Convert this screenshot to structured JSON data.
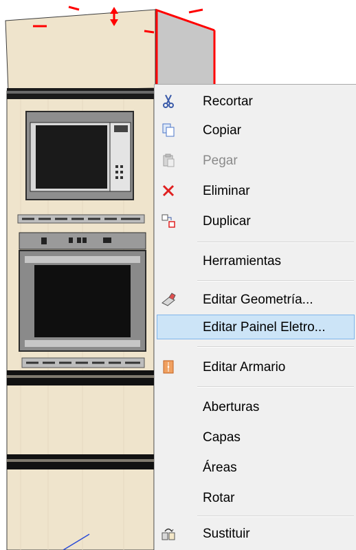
{
  "context_menu": {
    "items": [
      {
        "label": "Recortar",
        "icon": "scissors-icon",
        "enabled": true
      },
      {
        "label": "Copiar",
        "icon": "copy-icon",
        "enabled": true
      },
      {
        "label": "Pegar",
        "icon": "paste-icon",
        "enabled": false
      },
      {
        "label": "Eliminar",
        "icon": "delete-icon",
        "enabled": true
      },
      {
        "label": "Duplicar",
        "icon": "duplicate-icon",
        "enabled": true
      },
      {
        "label": "Herramientas",
        "icon": "",
        "enabled": true
      },
      {
        "label": "Editar Geometría...",
        "icon": "eraser-icon",
        "enabled": true
      },
      {
        "label": "Editar Painel Eletro...",
        "icon": "",
        "enabled": true,
        "highlighted": true
      },
      {
        "label": "Editar Armario",
        "icon": "cabinet-icon",
        "enabled": true
      },
      {
        "label": "Aberturas",
        "icon": "",
        "enabled": true
      },
      {
        "label": "Capas",
        "icon": "",
        "enabled": true
      },
      {
        "label": "Áreas",
        "icon": "",
        "enabled": true
      },
      {
        "label": "Rotar",
        "icon": "",
        "enabled": true
      },
      {
        "label": "Sustituir",
        "icon": "replace-icon",
        "enabled": true
      }
    ]
  },
  "colors": {
    "menu_bg": "#f0f0f0",
    "highlight_bg": "#cce4f7",
    "highlight_border": "#7eb4ea",
    "cabinet_wood": "#efe4cc",
    "cabinet_side": "#c4c4c4",
    "selection_red": "#ff0000"
  }
}
